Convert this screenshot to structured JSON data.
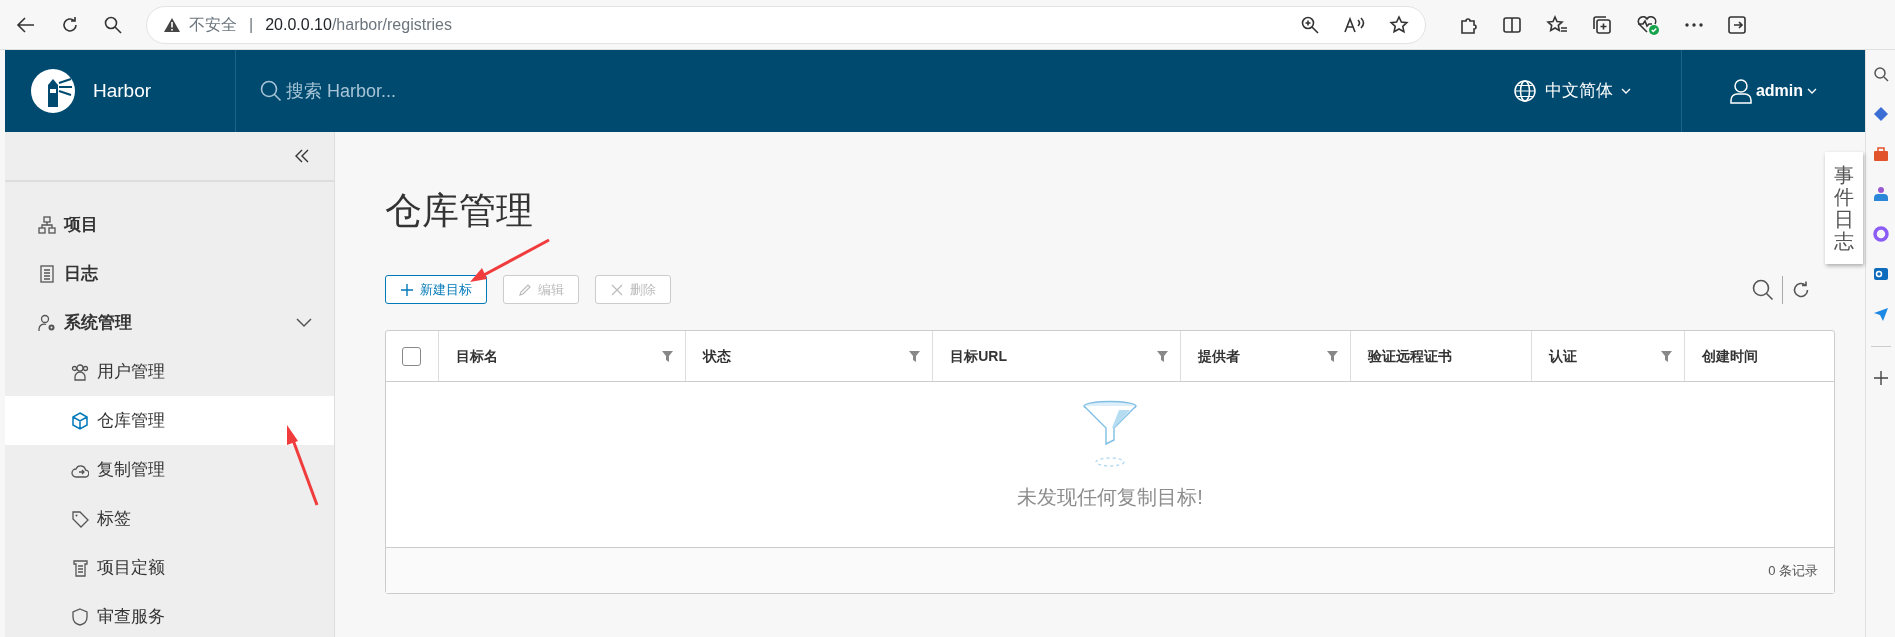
{
  "browser": {
    "security_label": "不安全",
    "separator": "|",
    "url_host": "20.0.0.10",
    "url_path": "/harbor/registries"
  },
  "header": {
    "brand": "Harbor",
    "search": {
      "placeholder": "搜索 Harbor..."
    },
    "language": "中文简体",
    "user": "admin"
  },
  "sidebar": {
    "items": [
      {
        "label": "项目",
        "selected": false
      },
      {
        "label": "日志",
        "selected": false
      },
      {
        "label": "系统管理",
        "selected": false,
        "expanded": true,
        "children": [
          {
            "label": "用户管理",
            "selected": false
          },
          {
            "label": "仓库管理",
            "selected": true
          },
          {
            "label": "复制管理",
            "selected": false
          },
          {
            "label": "标签",
            "selected": false
          },
          {
            "label": "项目定额",
            "selected": false
          },
          {
            "label": "审查服务",
            "selected": false
          }
        ]
      }
    ]
  },
  "page": {
    "title": "仓库管理",
    "toolbar": [
      {
        "label": "新建目标",
        "disabled": false
      },
      {
        "label": "编辑",
        "disabled": true
      },
      {
        "label": "删除",
        "disabled": true
      }
    ],
    "table": {
      "select_all_checked": false,
      "columns": [
        {
          "label": "目标名",
          "filterable": true
        },
        {
          "label": "状态",
          "filterable": true
        },
        {
          "label": "目标URL",
          "filterable": true
        },
        {
          "label": "提供者",
          "filterable": true
        },
        {
          "label": "验证远程证书",
          "filterable": false
        },
        {
          "label": "认证",
          "filterable": true
        },
        {
          "label": "创建时间",
          "filterable": false
        }
      ],
      "empty_message": "未发现任何复制目标!",
      "footer": "0 条记录"
    }
  },
  "event_log_tab": "事件日志"
}
